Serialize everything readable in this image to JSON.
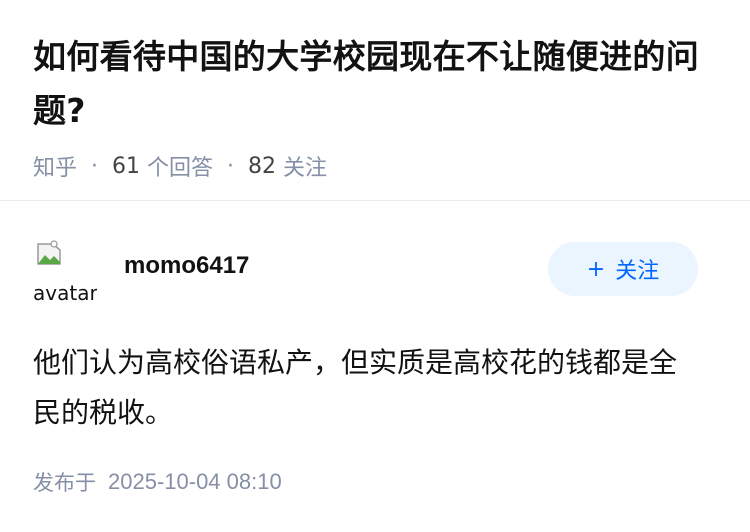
{
  "question": {
    "title": "如何看待中国的大学校园现在不让随便进的问题?",
    "source": "知乎",
    "answer_count": "61",
    "answer_label": "个回答",
    "follower_count": "82",
    "follower_label": "关注",
    "separator": "·"
  },
  "answer": {
    "author": {
      "avatar_alt": "avatar",
      "name": "momo6417"
    },
    "follow_button": {
      "plus": "+",
      "label": "关注"
    },
    "content": "他们认为高校俗语私产，但实质是高校花的钱都是全民的税收。",
    "published_label": "发布于",
    "published_time": "2025-10-04 08:10"
  },
  "colors": {
    "accent": "#0066ff",
    "button_bg": "#ebf5ff",
    "meta_text": "#8590a6"
  }
}
